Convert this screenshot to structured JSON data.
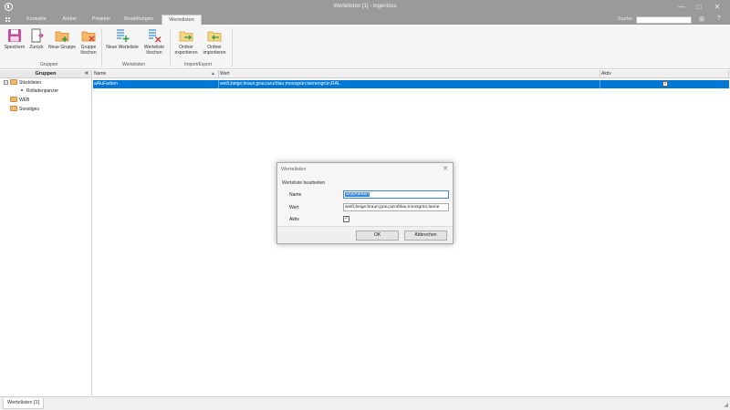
{
  "window": {
    "title": "Wertelisten [1] - ingenious",
    "min_glyph": "—",
    "max_glyph": "□",
    "close_glyph": "✕"
  },
  "menu": {
    "tabs": [
      {
        "label": "Kontakte"
      },
      {
        "label": "Artikel"
      },
      {
        "label": "Projekte"
      },
      {
        "label": "Bestellungen"
      },
      {
        "label": "Wertelisten"
      }
    ],
    "active_tab": "Wertelisten",
    "search_label": "Suche:",
    "search_value": "",
    "layout_icon_glyph": "⊞",
    "help_icon_glyph": "?"
  },
  "ribbon": {
    "save": "Speichern",
    "back": "Zurück",
    "new_group": "Neue Gruppe",
    "delete_group_1": "Gruppe",
    "delete_group_2": "löschen",
    "new_list": "Neue Werteliste",
    "delete_list_1": "Werteliste",
    "delete_list_2": "löschen",
    "export_1": "Ordner",
    "export_2": "exportieren",
    "import_1": "Ordner",
    "import_2": "importieren",
    "groups": {
      "gruppen": "Gruppen",
      "wertelisten": "Wertelisten",
      "import_export": "Import/Export"
    }
  },
  "left_panel": {
    "header": "Gruppen",
    "collapse_glyph": "«",
    "tree": {
      "stucklisten": "Stücklisten",
      "expander": "−",
      "child": "Rolladenpanzer",
      "web": "WEB",
      "sonstiges": "Sonstiges"
    }
  },
  "grid": {
    "columns": {
      "name": "Name",
      "wert": "Wert",
      "aktiv": "Aktiv"
    },
    "sort_glyph": "▲",
    "rows": [
      {
        "name": "aAluFarben",
        "wert": "weiß;beige;braun;grau;azurblau;moosgrün;tannengrün;RAL",
        "aktiv": true,
        "check_glyph": "✓"
      }
    ]
  },
  "dialog": {
    "title": "Wertelisten",
    "close_glyph": "✕",
    "group_label": "Werteliste bearbeiten",
    "name_label": "Name",
    "name_value": "aAluFarben",
    "wert_label": "Wert",
    "wert_value": "weiß;beige;braun;grau;azurblau;moosgrün;tanne",
    "aktiv_label": "Aktiv",
    "aktiv_checked": true,
    "check_glyph": "✓",
    "ok": "OK",
    "cancel": "Abbrechen"
  },
  "statusbar": {
    "tab": "Wertelisten [1]",
    "grip_glyph": "◢"
  },
  "colors": {
    "chrome": "#9a9a9a",
    "selection": "#0078d7",
    "folder": "#f0b878"
  }
}
